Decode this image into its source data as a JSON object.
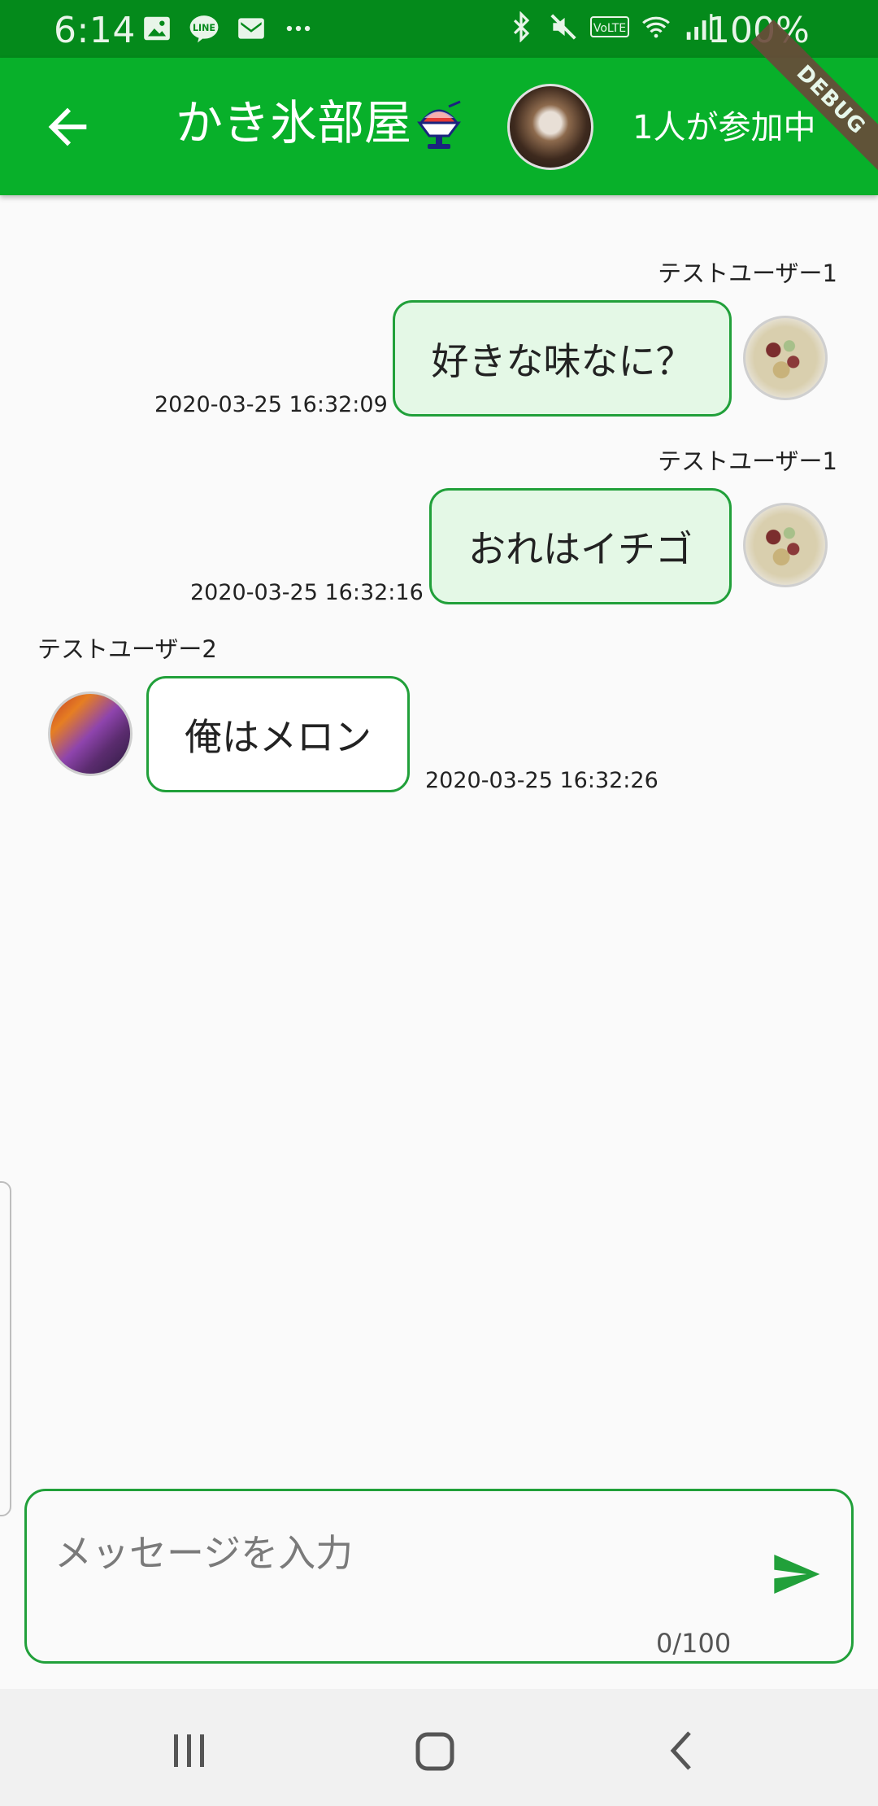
{
  "status_bar": {
    "time": "6:14",
    "battery": "100%",
    "icons": [
      "gallery-icon",
      "line-icon",
      "gmail-icon",
      "more-dots-icon",
      "bluetooth-icon",
      "mute-icon",
      "volte-icon",
      "wifi-icon",
      "signal-icon",
      "battery-icon"
    ],
    "volte_label": "VoLTE"
  },
  "app_bar": {
    "title": "かき氷部屋",
    "participants": "1人が参加中",
    "debug_label": "DEBUG",
    "color": "#08b02a"
  },
  "messages": [
    {
      "sender": "テストユーザー1",
      "text": "好きな味なに？",
      "timestamp": "2020-03-25 16:32:09",
      "side": "right"
    },
    {
      "sender": "テストユーザー1",
      "text": "おれはイチゴ",
      "timestamp": "2020-03-25 16:32:16",
      "side": "right"
    },
    {
      "sender": "テストユーザー2",
      "text": "俺はメロン",
      "timestamp": "2020-03-25 16:32:26",
      "side": "left"
    }
  ],
  "composer": {
    "placeholder": "メッセージを入力",
    "counter": "0/100",
    "accent": "#21a03a"
  }
}
